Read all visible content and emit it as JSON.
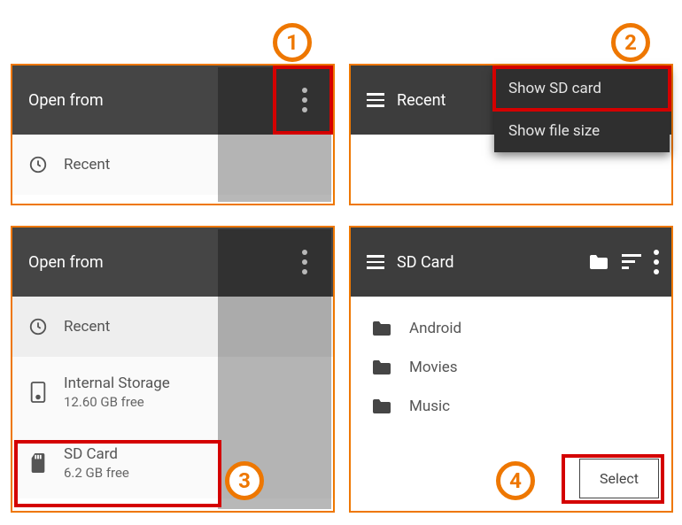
{
  "callouts": {
    "n1": "1",
    "n2": "2",
    "n3": "3",
    "n4": "4"
  },
  "panel1": {
    "title": "Open from",
    "recent": "Recent"
  },
  "panel2": {
    "title": "Recent",
    "menu": {
      "opt1": "Show SD card",
      "opt2": "Show file size"
    }
  },
  "panel3": {
    "title": "Open from",
    "items": [
      {
        "label": "Recent"
      },
      {
        "label": "Internal Storage",
        "sub": "12.60 GB free"
      },
      {
        "label": "SD Card",
        "sub": "6.2 GB free"
      }
    ]
  },
  "panel4": {
    "title": "SD Card",
    "folders": [
      {
        "name": "Android"
      },
      {
        "name": "Movies"
      },
      {
        "name": "Music"
      }
    ],
    "select": "Select"
  }
}
